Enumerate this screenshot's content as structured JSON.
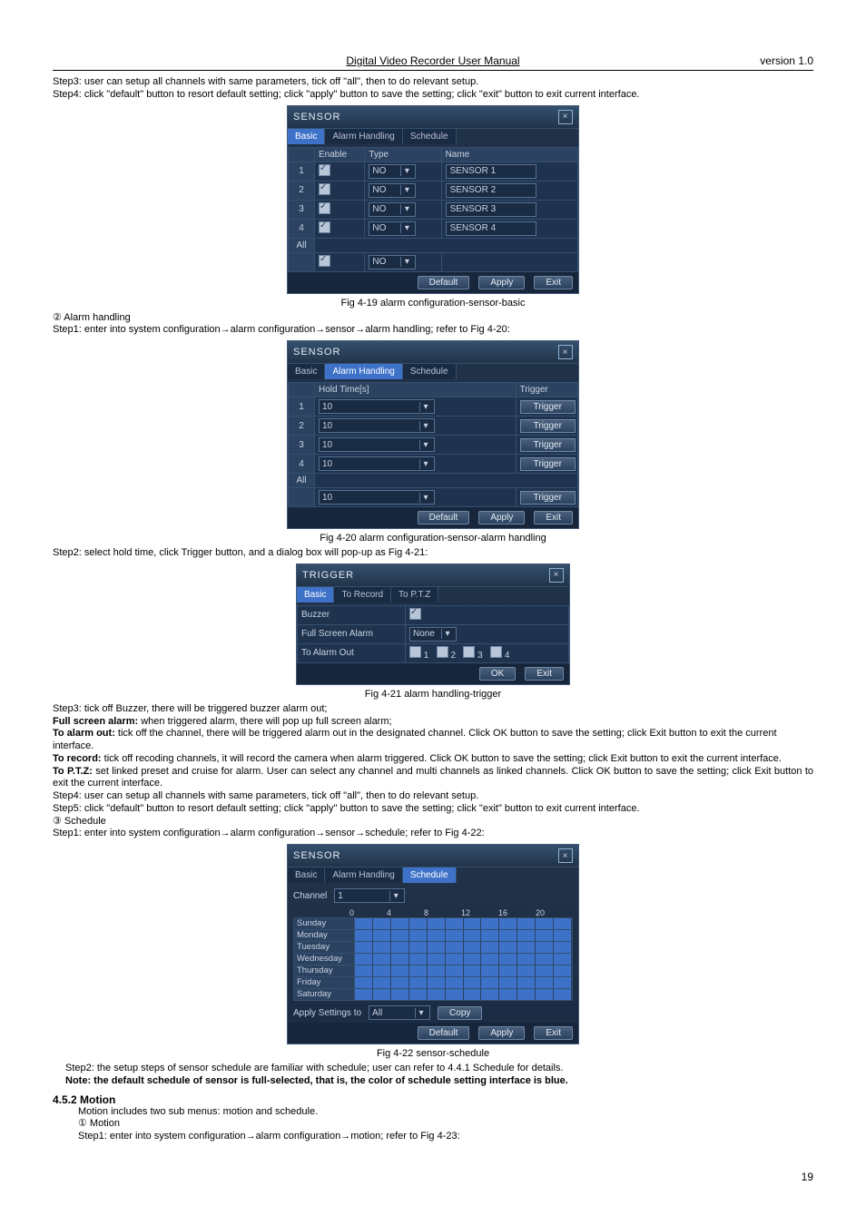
{
  "header": {
    "title": "Digital Video Recorder User Manual",
    "version": "version 1.0"
  },
  "intro": {
    "step3": "Step3: user can setup all channels with same parameters, tick off \"all\", then to do relevant setup.",
    "step4": "Step4: click \"default\" button to resort default setting; click \"apply\" button to save the setting; click \"exit\" button to exit current interface."
  },
  "fig419": {
    "panel_title": "SENSOR",
    "tabs": [
      "Basic",
      "Alarm Handling",
      "Schedule"
    ],
    "active_tab": 0,
    "columns": [
      "",
      "Enable",
      "Type",
      "Name"
    ],
    "rows": [
      {
        "idx": "1",
        "enable": true,
        "type": "NO",
        "name": "SENSOR 1"
      },
      {
        "idx": "2",
        "enable": true,
        "type": "NO",
        "name": "SENSOR 2"
      },
      {
        "idx": "3",
        "enable": true,
        "type": "NO",
        "name": "SENSOR 3"
      },
      {
        "idx": "4",
        "enable": true,
        "type": "NO",
        "name": "SENSOR 4"
      }
    ],
    "all_row": {
      "label": "All",
      "enable": true,
      "type": "NO"
    },
    "buttons": {
      "default": "Default",
      "apply": "Apply",
      "exit": "Exit"
    },
    "caption": "Fig 4-19 alarm configuration-sensor-basic"
  },
  "alarm_handling": {
    "numbered": "②   Alarm handling",
    "step1": "Step1: enter into system configuration→alarm configuration→sensor→alarm handling; refer to Fig 4-20:"
  },
  "fig420": {
    "panel_title": "SENSOR",
    "tabs": [
      "Basic",
      "Alarm Handling",
      "Schedule"
    ],
    "active_tab": 1,
    "columns": [
      "",
      "Hold Time[s]",
      "Trigger"
    ],
    "rows": [
      {
        "idx": "1",
        "hold": "10",
        "trig": "Trigger"
      },
      {
        "idx": "2",
        "hold": "10",
        "trig": "Trigger"
      },
      {
        "idx": "3",
        "hold": "10",
        "trig": "Trigger"
      },
      {
        "idx": "4",
        "hold": "10",
        "trig": "Trigger"
      }
    ],
    "all_row": {
      "label": "All",
      "hold": "10",
      "trig": "Trigger"
    },
    "buttons": {
      "default": "Default",
      "apply": "Apply",
      "exit": "Exit"
    },
    "caption": "Fig 4-20 alarm configuration-sensor-alarm handling"
  },
  "step2_trigger": "Step2: select hold time, click Trigger button, and a dialog box will pop-up as Fig 4-21:",
  "fig421": {
    "panel_title": "TRIGGER",
    "tabs": [
      "Basic",
      "To Record",
      "To P.T.Z"
    ],
    "active_tab": 0,
    "rows": {
      "buzzer_label": "Buzzer",
      "buzzer_on": true,
      "fsa_label": "Full Screen Alarm",
      "fsa_value": "None",
      "tao_label": "To Alarm Out",
      "tao_opts": [
        "1",
        "2",
        "3",
        "4"
      ]
    },
    "buttons": {
      "ok": "OK",
      "exit": "Exit"
    },
    "caption": "Fig 4-21 alarm handling-trigger"
  },
  "after421": {
    "step3": "Step3: tick off Buzzer, there will be triggered buzzer alarm out;",
    "fsa_b": "Full screen alarm:",
    "fsa": " when triggered alarm, there will pop up full screen alarm;",
    "tao_b": "To alarm out:",
    "tao": " tick off the channel, there will be triggered alarm out in the designated channel. Click OK button to save the setting; click Exit button to exit the current interface.",
    "tr_b": "To record:",
    "tr": " tick off recoding channels, it will record the camera when alarm triggered. Click OK button to save the setting; click Exit button to exit the current interface.",
    "tp_b": "To P.T.Z:",
    "tp": " set linked preset and cruise for alarm. User can select any channel and multi channels as linked channels. Click OK button to save the setting; click Exit button to exit the current interface.",
    "step4": "Step4: user can setup all channels with same parameters, tick off \"all\", then to do relevant setup.",
    "step5": "Step5: click \"default\" button to resort default setting; click \"apply\" button to save the setting; click \"exit\" button to exit current interface.",
    "schedule_num": "③   Schedule",
    "step1_sched": "Step1: enter into system configuration→alarm configuration→sensor→schedule; refer to Fig 4-22:"
  },
  "fig422": {
    "panel_title": "SENSOR",
    "tabs": [
      "Basic",
      "Alarm Handling",
      "Schedule"
    ],
    "active_tab": 2,
    "channel_label": "Channel",
    "channel_value": "1",
    "ticks": [
      "0",
      "4",
      "8",
      "12",
      "16",
      "20"
    ],
    "days": [
      "Sunday",
      "Monday",
      "Tuesday",
      "Wednesday",
      "Thursday",
      "Friday",
      "Saturday"
    ],
    "apply_label": "Apply Settings to",
    "apply_value": "All",
    "copy": "Copy",
    "buttons": {
      "default": "Default",
      "apply": "Apply",
      "exit": "Exit"
    },
    "caption": "Fig 4-22 sensor-schedule"
  },
  "after422": {
    "step2": "Step2: the setup steps of sensor schedule are familiar with schedule; user can refer to 4.4.1 Schedule for details.",
    "note": "Note: the default schedule of sensor is full-selected, that is, the color of schedule setting interface is blue."
  },
  "motion": {
    "heading": "4.5.2 Motion",
    "line1": "Motion includes two sub menus: motion and schedule.",
    "num": "①   Motion",
    "step1": "Step1: enter into system configuration→alarm configuration→motion; refer to Fig 4-23:"
  },
  "page_number": "19"
}
